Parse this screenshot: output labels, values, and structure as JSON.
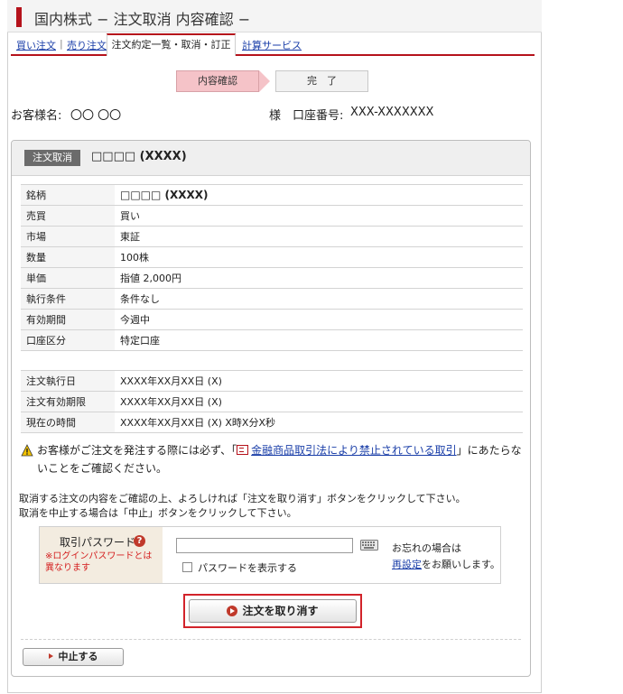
{
  "header": {
    "title": "国内株式 − 注文取消 内容確認 −"
  },
  "tabs": {
    "buy": "買い注文",
    "sell": "売り注文",
    "active": "注文約定一覧・取消・訂正",
    "calc": "計算サービス",
    "sep": "|"
  },
  "steps": {
    "current": "内容確認",
    "next": "完　了"
  },
  "customer": {
    "name_label": "お客様名:",
    "name_value": "〇〇 〇〇",
    "honorific": "様",
    "account_label": "口座番号:",
    "account_value": "XXX-XXXXXXX"
  },
  "order_box": {
    "badge": "注文取消",
    "stock": "□□□□ (XXXX)"
  },
  "details": [
    {
      "label": "銘柄",
      "value": "□□□□ (XXXX)"
    },
    {
      "label": "売買",
      "value": "買い"
    },
    {
      "label": "市場",
      "value": "東証"
    },
    {
      "label": "数量",
      "value": "100株"
    },
    {
      "label": "単価",
      "value": "指値 2,000円"
    },
    {
      "label": "執行条件",
      "value": "条件なし"
    },
    {
      "label": "有効期間",
      "value": "今週中"
    },
    {
      "label": "口座区分",
      "value": "特定口座"
    }
  ],
  "dates": [
    {
      "label": "注文執行日",
      "value": "XXXX年XX月XX日 (X)"
    },
    {
      "label": "注文有効期限",
      "value": "XXXX年XX月XX日 (X)"
    },
    {
      "label": "現在の時間",
      "value": "XXXX年XX月XX日 (X) X時X分X秒"
    }
  ],
  "notice": {
    "before": "お客様がご注文を発注する際には必ず、「",
    "link": "金融商品取引法により禁止されている取引",
    "after": "」にあたらないことをご確認ください。"
  },
  "instructions": {
    "line1": "取消する注文の内容をご確認の上、よろしければ「注文を取り消す」ボタンをクリックして下さい。",
    "line2": "取消を中止する場合は「中止」ボタンをクリックして下さい。"
  },
  "password": {
    "label": "取引パスワード",
    "help": "?",
    "note": "※ログインパスワードとは異なります",
    "show_label": "パスワードを表示する",
    "forgot_line1": "お忘れの場合は",
    "forgot_link": "再設定",
    "forgot_after": "をお願いします。"
  },
  "buttons": {
    "submit": "注文を取り消す",
    "stop": "中止する"
  },
  "colors": {
    "accent": "#b5121b",
    "link": "#1a3ea8",
    "step_active": "#f5c3c8"
  }
}
